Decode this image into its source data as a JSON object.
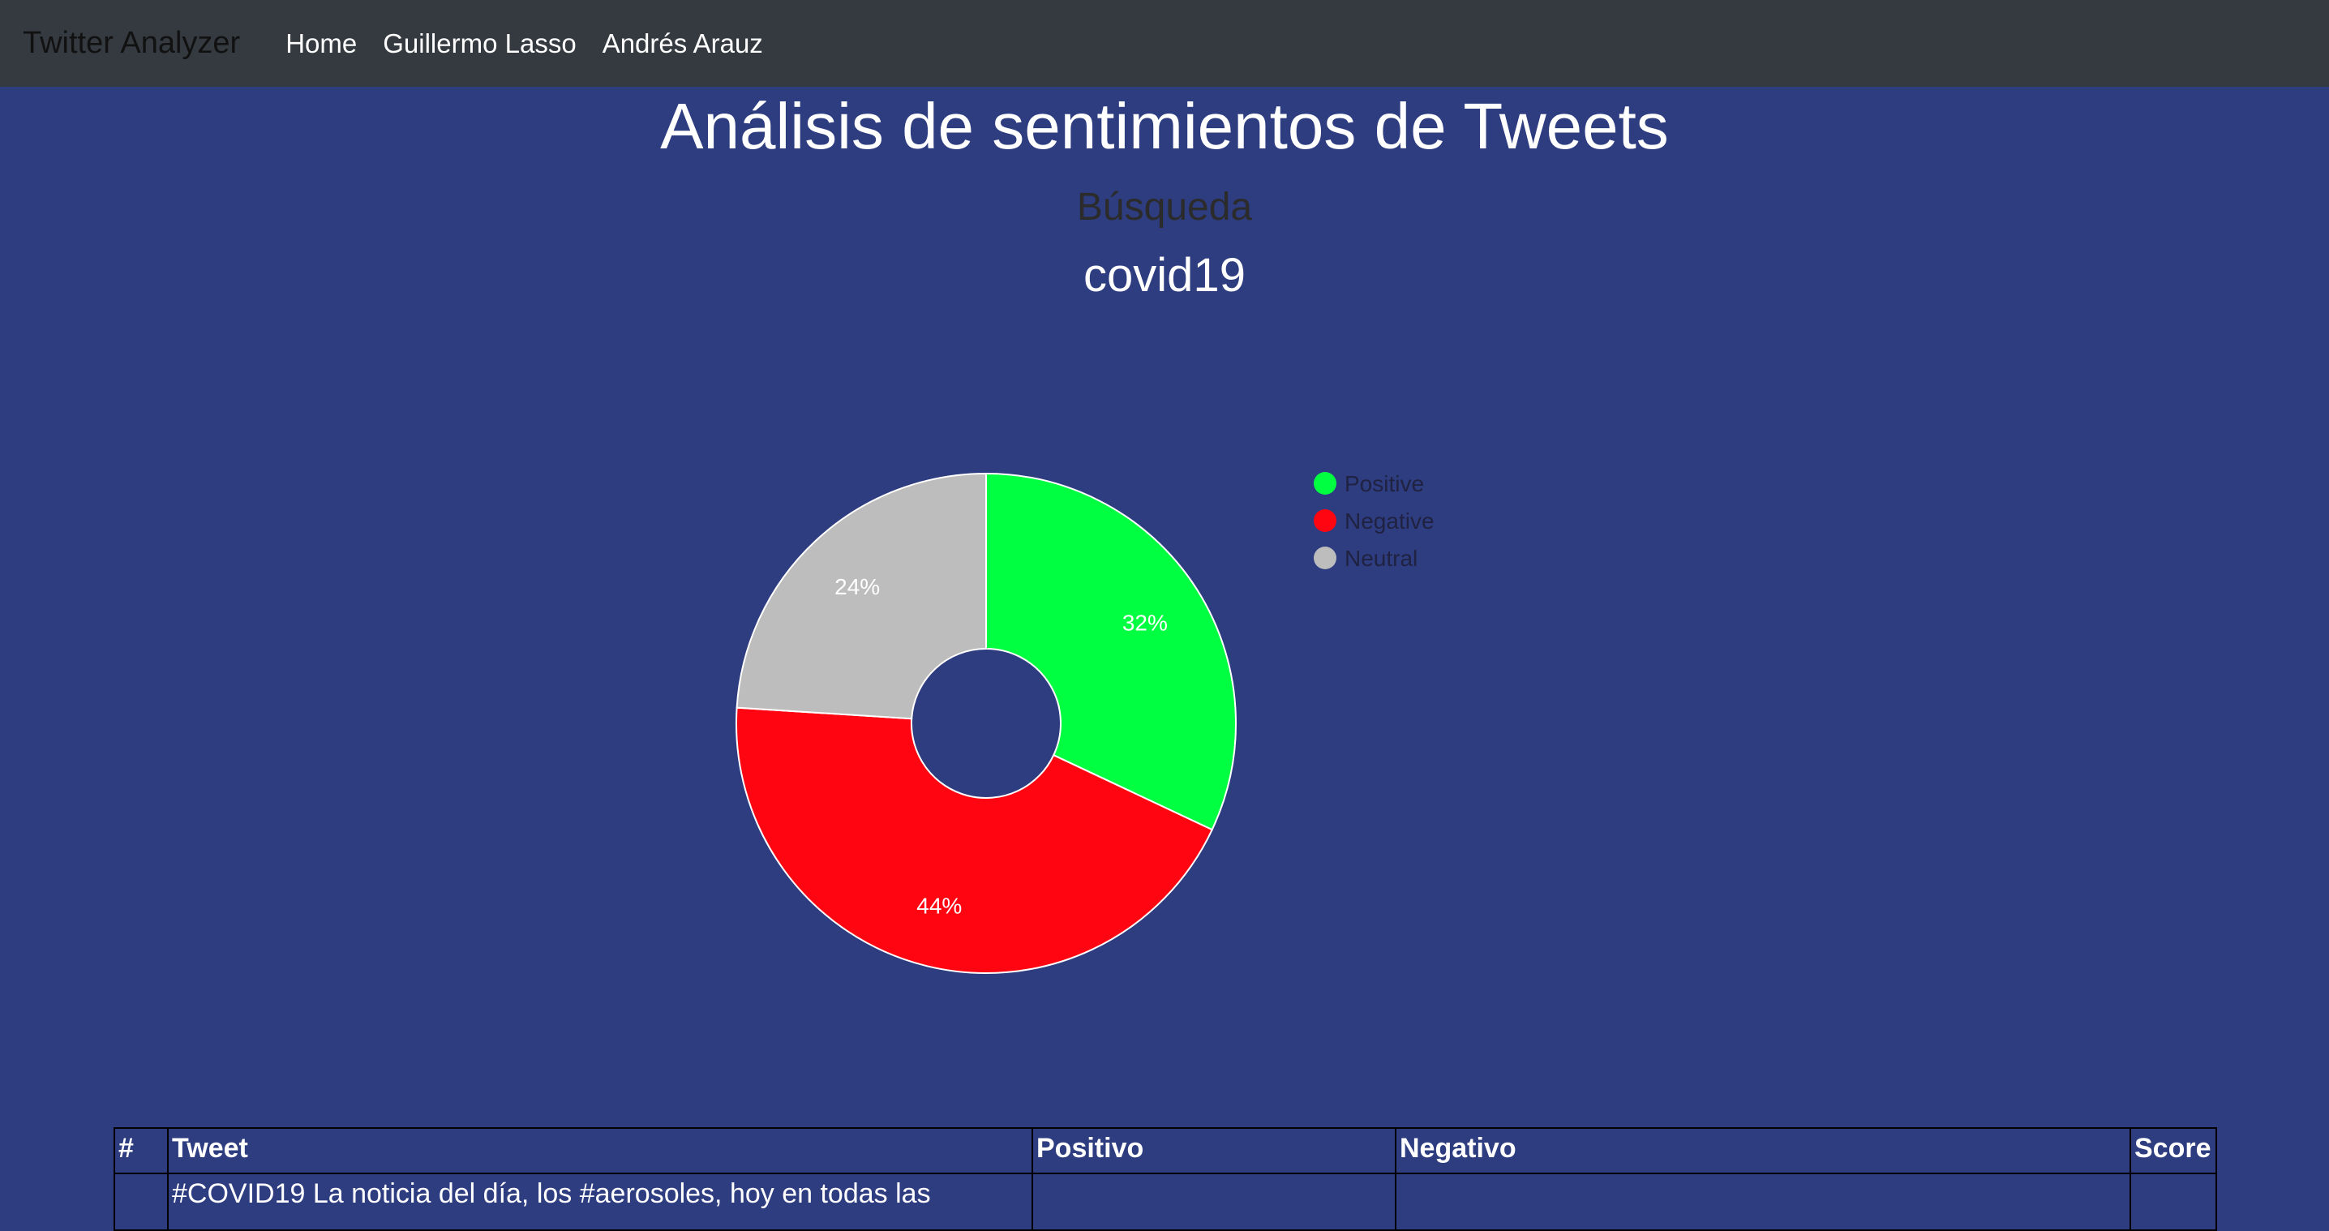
{
  "navbar": {
    "brand": "Twitter Analyzer",
    "links": [
      "Home",
      "Guillermo Lasso",
      "Andrés Arauz"
    ]
  },
  "page": {
    "title": "Análisis de sentimientos de Tweets",
    "subtitle": "Búsqueda",
    "query": "covid19"
  },
  "chart_data": {
    "type": "pie",
    "donut": true,
    "legend_placement": "top-right",
    "slices": [
      {
        "label": "Positive",
        "value": 32,
        "display": "32%",
        "color": "#00ff41"
      },
      {
        "label": "Negative",
        "value": 44,
        "display": "44%",
        "color": "#ff0512"
      },
      {
        "label": "Neutral",
        "value": 24,
        "display": "24%",
        "color": "#bdbdbd"
      }
    ],
    "label_color": "#ffffff",
    "legend_text_color": "#1f2240"
  },
  "table": {
    "headers": [
      "#",
      "Tweet",
      "Positivo",
      "Negativo",
      "Score"
    ],
    "rows": [
      [
        "",
        "#COVID19 La noticia del día, los #aerosoles, hoy en todas las",
        "",
        "",
        ""
      ]
    ]
  }
}
